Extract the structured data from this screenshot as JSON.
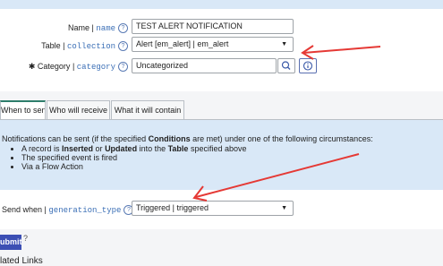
{
  "form": {
    "name": {
      "label": "Name",
      "sep": " | ",
      "api": "name",
      "value": "TEST ALERT NOTIFICATION"
    },
    "table": {
      "label": "Table",
      "sep": " | ",
      "api": "collection",
      "value": "Alert [em_alert] | em_alert"
    },
    "category": {
      "mandatory": "✱",
      "label": "Category",
      "sep": " | ",
      "api": "category",
      "value": "Uncategorized"
    }
  },
  "tabs": [
    "When to send",
    "Who will receive",
    "What it will contain"
  ],
  "panel": {
    "intro_pre": "Notifications can be sent (if the specified ",
    "intro_bold": "Conditions",
    "intro_post": " are met) under one of the following circumstances:",
    "b1_a": "A record is ",
    "b1_b": "Inserted",
    "b1_c": " or ",
    "b1_d": "Updated",
    "b1_e": " into the ",
    "b1_f": "Table",
    "b1_g": " specified above",
    "b2": "The specified event is fired",
    "b3": "Via a Flow Action"
  },
  "send_when": {
    "label": "Send when",
    "sep": " | ",
    "api": "generation_type",
    "value": "Triggered | triggered"
  },
  "submit": "ubmit",
  "submit_help": "?",
  "bottom": "lated Links",
  "icons": {
    "help": "?",
    "search": "magnifier-icon",
    "info": "info-icon",
    "chevron": "▼"
  },
  "colors": {
    "arrow": "#e53935",
    "accent": "#3c4fb4",
    "panel": "#d9e8f7"
  }
}
